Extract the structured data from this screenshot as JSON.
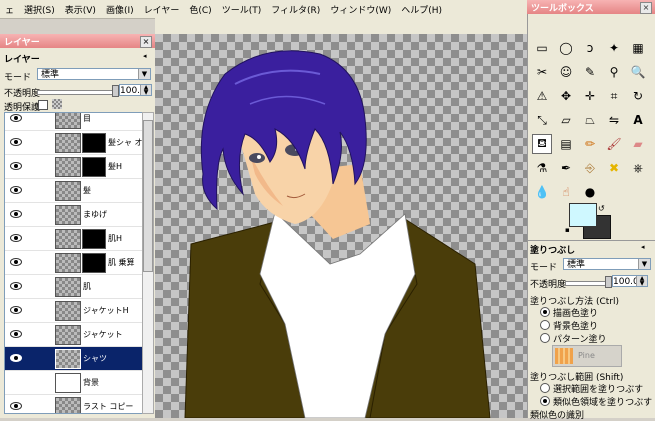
{
  "menubar": {
    "items": [
      "ェ",
      "選択(S)",
      "表示(V)",
      "画像(I)",
      "レイヤー",
      "色(C)",
      "ツール(T)",
      "フィルタ(R)",
      "ウィンドウ(W)",
      "ヘルプ(H)"
    ]
  },
  "layers_panel": {
    "title": "レイヤー",
    "section_label": "レイヤー",
    "mode_label": "モード",
    "mode_value": "標準",
    "opacity_label": "不透明度",
    "opacity_value": "100.0",
    "lock_label": "透明保護",
    "layers": [
      {
        "name": "目",
        "has_mask": false,
        "selected": false
      },
      {
        "name": "髪シャ  オー",
        "has_mask": true,
        "selected": false
      },
      {
        "name": "髪H",
        "has_mask": true,
        "selected": false
      },
      {
        "name": "髪",
        "has_mask": false,
        "selected": false
      },
      {
        "name": "まゆげ",
        "has_mask": false,
        "selected": false
      },
      {
        "name": "肌H",
        "has_mask": true,
        "selected": false
      },
      {
        "name": "肌  乗算",
        "has_mask": true,
        "selected": false
      },
      {
        "name": "肌",
        "has_mask": false,
        "selected": false
      },
      {
        "name": "ジャケットH",
        "has_mask": false,
        "selected": false
      },
      {
        "name": "ジャケット",
        "has_mask": false,
        "selected": false
      },
      {
        "name": "シャツ",
        "has_mask": false,
        "selected": true
      },
      {
        "name": "背景",
        "has_mask": false,
        "selected": false
      },
      {
        "name": "ラスト コピー",
        "has_mask": false,
        "selected": false
      }
    ]
  },
  "toolbox": {
    "title": "ツールボックス",
    "foreground_color": "#cff8ff",
    "background_color": "#333333"
  },
  "tool_options": {
    "title": "塗りつぶし",
    "mode_label": "モード",
    "mode_value": "標準",
    "opacity_label": "不透明度",
    "opacity_value": "100.0",
    "fill_type_label": "塗りつぶし方法 (Ctrl)",
    "fill_types": [
      "描画色塗り",
      "背景色塗り",
      "パターン塗り"
    ],
    "fill_type_selected": 0,
    "pattern_name": "Pine",
    "range_label": "塗りつぶし範囲 (Shift)",
    "ranges": [
      "選択範囲を塗りつぶす",
      "類似色領域を塗りつぶす"
    ],
    "range_selected": 1,
    "similar_label": "類似色の識別"
  }
}
